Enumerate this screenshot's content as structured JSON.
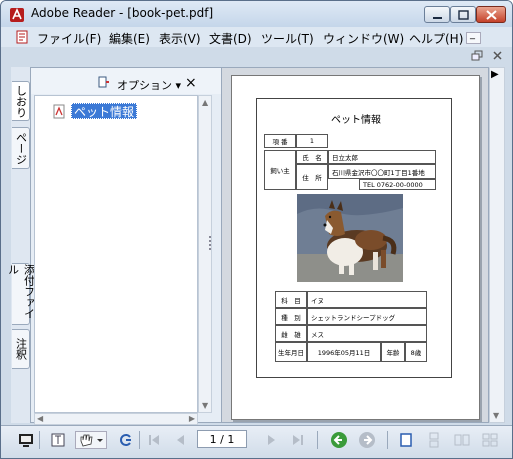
{
  "window": {
    "title": "Adobe Reader - [book-pet.pdf]"
  },
  "menu": {
    "items": [
      {
        "label": "ファイル(F)"
      },
      {
        "label": "編集(E)"
      },
      {
        "label": "表示(V)"
      },
      {
        "label": "文書(D)"
      },
      {
        "label": "ツール(T)"
      },
      {
        "label": "ウィンドウ(W)"
      },
      {
        "label": "ヘルプ(H)"
      }
    ],
    "minimize_label": "_"
  },
  "nav_pane": {
    "tabs": [
      "しおり",
      "ページ",
      "添付ファイル",
      "注釈"
    ],
    "options_label": "オプション ▾",
    "close_label": "×",
    "bookmarks": [
      {
        "label": "ペット情報",
        "selected": true
      }
    ]
  },
  "pdf": {
    "title": "ペット情報",
    "fields": {
      "item_no_label": "項 番",
      "item_no_value": "1",
      "owner_label": "飼い主",
      "name_label": "氏　名",
      "name_value": "日立太郎",
      "address_label": "住　所",
      "address_value": "石川県金沢市〇〇町1丁目1番地",
      "tel_value": "TEL 0762-00-0000",
      "family_label": "科　目",
      "family_value": "イヌ",
      "breed_label": "種　別",
      "breed_value": "シェットランドシープドッグ",
      "sex_label": "雌　雄",
      "sex_value": "メス",
      "birth_label": "生年月日",
      "birth_value": "1996年05月11日",
      "age_label": "年齢",
      "age_value": "8歳"
    }
  },
  "toolbar": {
    "page_indicator": "1 / 1"
  },
  "colors": {
    "selection": "#3b79d6",
    "title_bar": "#c5d6ea",
    "close_button": "#c4412a"
  }
}
